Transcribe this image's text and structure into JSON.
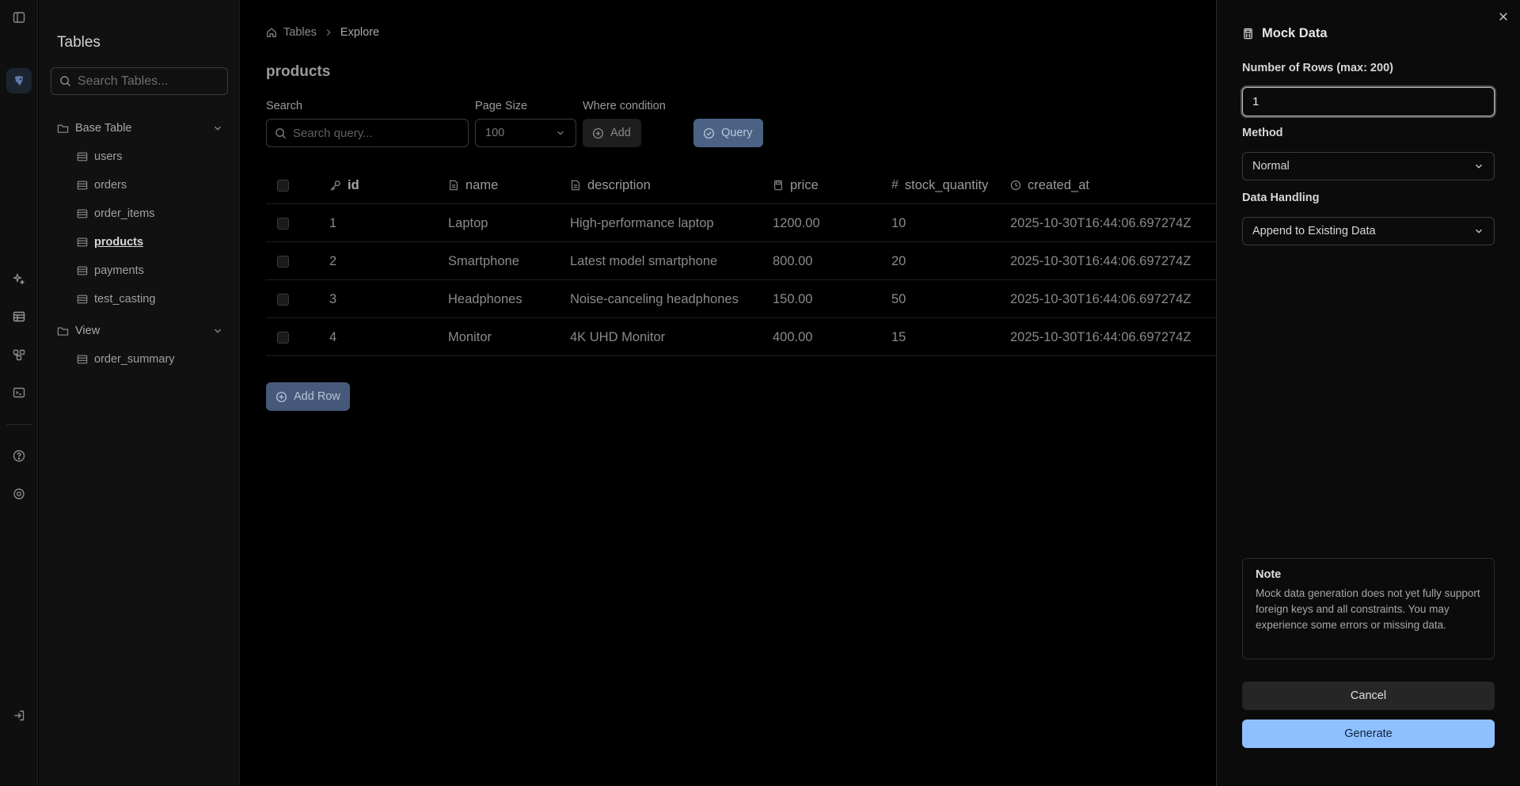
{
  "sidebar": {
    "title": "Tables",
    "search_placeholder": "Search Tables...",
    "groups": [
      {
        "label": "Base Table",
        "items": [
          "users",
          "orders",
          "order_items",
          "products",
          "payments",
          "test_casting"
        ]
      },
      {
        "label": "View",
        "items": [
          "order_summary"
        ]
      }
    ],
    "active_item": "products"
  },
  "breadcrumb": {
    "home": "Tables",
    "current": "Explore"
  },
  "page": {
    "title": "products"
  },
  "filters": {
    "search_label": "Search",
    "search_placeholder": "Search query...",
    "page_size_label": "Page Size",
    "page_size_value": "100",
    "where_label": "Where condition",
    "add_label": "Add",
    "query_label": "Query"
  },
  "table": {
    "columns": [
      "id",
      "name",
      "description",
      "price",
      "stock_quantity",
      "created_at"
    ],
    "rows": [
      [
        "1",
        "Laptop",
        "High-performance laptop",
        "1200.00",
        "10",
        "2025-10-30T16:44:06.697274Z"
      ],
      [
        "2",
        "Smartphone",
        "Latest model smartphone",
        "800.00",
        "20",
        "2025-10-30T16:44:06.697274Z"
      ],
      [
        "3",
        "Headphones",
        "Noise-canceling headphones",
        "150.00",
        "50",
        "2025-10-30T16:44:06.697274Z"
      ],
      [
        "4",
        "Monitor",
        "4K UHD Monitor",
        "400.00",
        "15",
        "2025-10-30T16:44:06.697274Z"
      ]
    ],
    "add_row_label": "Add Row"
  },
  "panel": {
    "title": "Mock Data",
    "rows_label": "Number of Rows (max: 200)",
    "rows_value": "1",
    "method_label": "Method",
    "method_value": "Normal",
    "handling_label": "Data Handling",
    "handling_value": "Append to Existing Data",
    "note_title": "Note",
    "note_body": "Mock data generation does not yet fully support foreign keys and all constraints. You may experience some errors or missing data.",
    "cancel_label": "Cancel",
    "generate_label": "Generate"
  },
  "colors": {
    "background": "#000000",
    "sidebar": "#111111",
    "accent": "#8ec0ff",
    "query_button": "#4b6284"
  }
}
